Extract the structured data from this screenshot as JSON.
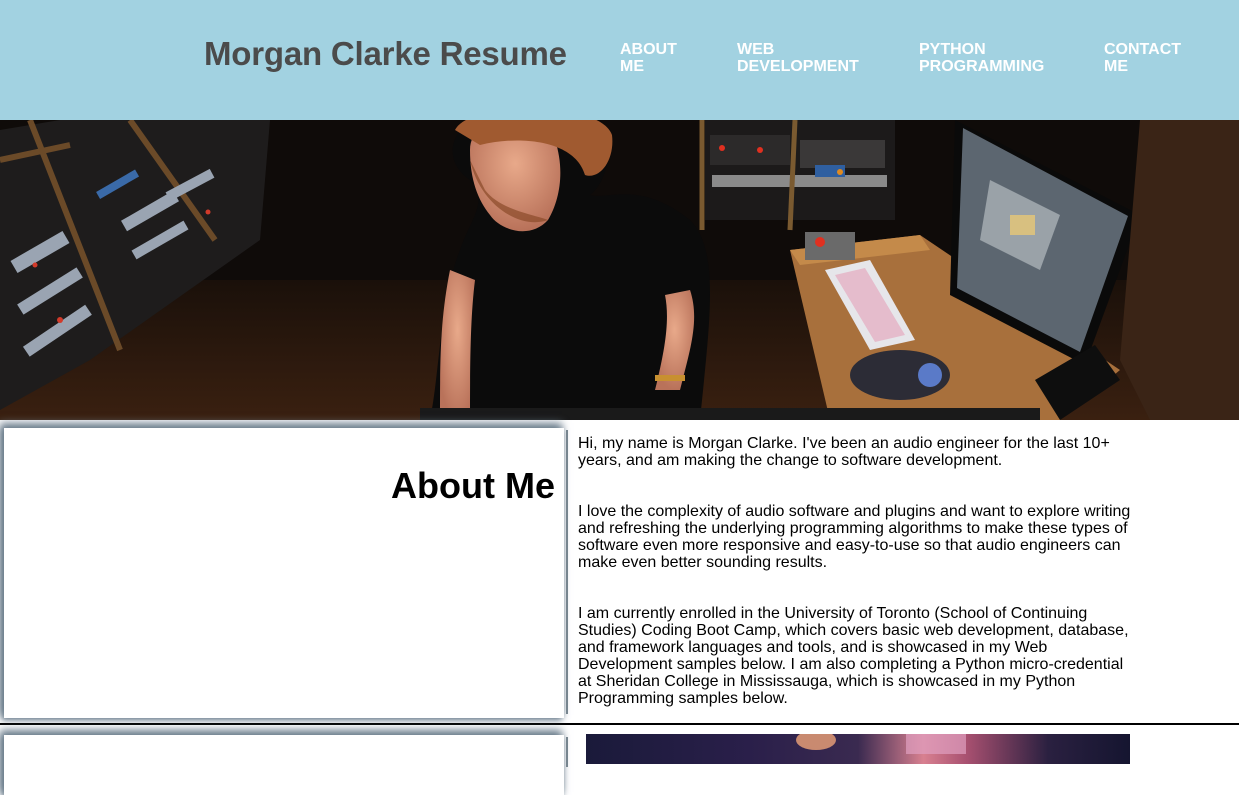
{
  "header": {
    "title": "Morgan Clarke Resume",
    "nav": [
      {
        "label": "ABOUT ME"
      },
      {
        "label": "WEB DEVELOPMENT"
      },
      {
        "label": "PYTHON PROGRAMMING"
      },
      {
        "label": "CONTACT ME"
      }
    ],
    "background_color": "#a2d2e1"
  },
  "about": {
    "heading": "About Me",
    "paragraphs": [
      "Hi, my name is Morgan Clarke. I've been an audio engineer for the last 10+ years, and am making the change to software development.",
      "I love the complexity of audio software and plugins and want to explore writing and refreshing the underlying programming algorithms to make these types of software even more responsive and easy-to-use so that audio engineers can make even better sounding results.",
      "I am currently enrolled in the University of Toronto (School of Continuing Studies) Coding Boot Camp, which covers basic web development, database, and framework languages and tools, and is showcased in my Web Development samples below. I am also completing a Python micro-credential at Sheridan College in Mississauga, which is showcased in my Python Programming samples below."
    ]
  }
}
